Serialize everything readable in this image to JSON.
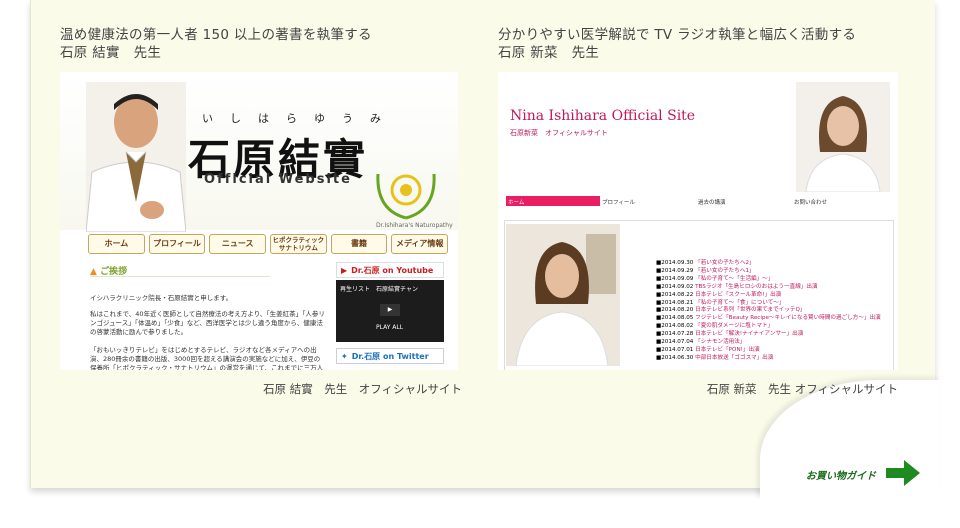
{
  "columns": [
    {
      "headline_line1": "温め健康法の第一人者 150 以上の著書を執筆する",
      "headline_line2": "石原 結實　先生",
      "caption": "石原 結實　先生　オフィシャルサイト",
      "site": {
        "ruby": "いしはらゆうみ",
        "title": "石原結實",
        "subtitle": "Official Website",
        "emblem_caption": "Dr.Ishihara's Naturopathy",
        "nav": [
          "ホーム",
          "プロフィール",
          "ニュース",
          "ヒポクラティック\nサナトリウム",
          "書籍",
          "メディア情報"
        ],
        "greeting_heading": "ご挨拶",
        "paragraphs": [
          "イシハラクリニック院長・石原結實と申します。",
          "私はこれまで、40年近く医師として自然療法の考え方より、「生姜紅茶」「人参リンゴジュース」「体温め」「少食」など、西洋医学とは少し違う角度から、健康法の啓蒙活動に励んで参りました。",
          "「おもいッきりテレビ」をはじめとするテレビ、ラジオなど各メディアへの出演、280冊余の書籍の出版、3000回を超える講演会の実施などに加え、伊豆の保養所「ヒポクラティック・サナトリウム」の運営を通じて、これまでに三万人の方々"
        ],
        "youtube_label": "Dr.石原 on Youtube",
        "video_list_label": "再生リスト",
        "video_title": "石原結實チャン",
        "play_all": "PLAY ALL",
        "twitter_label": "Dr.石原 on Twitter"
      }
    },
    {
      "headline_line1": "分かりやすい医学解説で TV ラジオ執筆と幅広く活動する",
      "headline_line2": "石原 新菜　先生",
      "caption": "石原 新菜　先生 オフィシャルサイト",
      "site": {
        "title": "Nina Ishihara Official Site",
        "subtitle": "石原新菜　オフィシャルサイト",
        "nav": [
          "ホーム",
          "プロフィール",
          "過去の講演",
          "お問い合わせ"
        ],
        "news": [
          {
            "date": "■2014.09.30",
            "text": "「若い女の子たちへ2」"
          },
          {
            "date": "■2014.09.29",
            "text": "「若い女の子たちへ1」"
          },
          {
            "date": "■2014.09.09",
            "text": "「私の子育て〜「生活編」〜」"
          },
          {
            "date": "■2014.09.02",
            "text": "TBSラジオ「生島ヒロシのおはよう一直線」出演"
          },
          {
            "date": "■2014.08.22",
            "text": "日本テレビ「スクール革命!」出演"
          },
          {
            "date": "■2014.08.21",
            "text": "「私の子育て〜「食」について〜」"
          },
          {
            "date": "■2014.08.20",
            "text": "日本テレビ系列「世界の果てまでイッテQ」"
          },
          {
            "date": "■2014.08.05",
            "text": "フジテレビ「Beauty Recipe〜キレイになる賢い時間の過ごし方〜」出演"
          },
          {
            "date": "■2014.08.02",
            "text": "「夏の肌ダメージに塩トマト」"
          },
          {
            "date": "■2014.07.28",
            "text": "日本テレビ「解決!ナイナイアンサー」出演"
          },
          {
            "date": "■2014.07.04",
            "text": "「シナモン活用法」"
          },
          {
            "date": "■2014.07.01",
            "text": "日本テレビ「PON!」出演"
          },
          {
            "date": "■2014.06.30",
            "text": "中部日本放送「ゴゴスマ」出演"
          }
        ]
      }
    }
  ],
  "footer": {
    "guide_label": "お買い物ガイド"
  },
  "colors": {
    "panel": "#fbfbea",
    "accent_pink": "#e91e63",
    "guide_green": "#1b6b1b"
  }
}
